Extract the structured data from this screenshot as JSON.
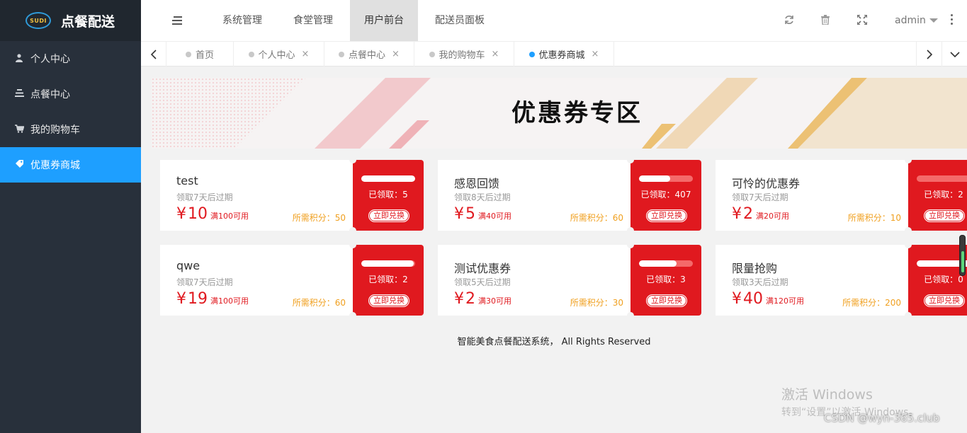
{
  "app": {
    "logo_badge": "SUDI",
    "title": "点餐配送"
  },
  "sidebar": {
    "items": [
      {
        "label": "个人中心",
        "icon": "user-icon"
      },
      {
        "label": "点餐中心",
        "icon": "list-icon"
      },
      {
        "label": "我的购物车",
        "icon": "cart-icon"
      },
      {
        "label": "优惠券商城",
        "icon": "tag-icon",
        "active": true
      }
    ]
  },
  "header": {
    "nav": [
      {
        "label": "系统管理"
      },
      {
        "label": "食堂管理"
      },
      {
        "label": "用户前台",
        "active": true
      },
      {
        "label": "配送员面板"
      }
    ],
    "user": "admin"
  },
  "tabs": {
    "items": [
      {
        "label": "首页",
        "closable": false
      },
      {
        "label": "个人中心",
        "closable": true
      },
      {
        "label": "点餐中心",
        "closable": true
      },
      {
        "label": "我的购物车",
        "closable": true
      },
      {
        "label": "优惠券商城",
        "closable": true,
        "active": true
      }
    ],
    "close_glyph": "×"
  },
  "banner": {
    "title": "优惠券专区"
  },
  "coupons": [
    {
      "name": "test",
      "expire": "领取7天后过期",
      "yen": "¥",
      "amount": "10",
      "condition": "满100可用",
      "points": "所需积分：50",
      "claimed": "已领取：5",
      "claimed_fraction": 1.0,
      "redeem": "立即兑换"
    },
    {
      "name": "感恩回馈",
      "expire": "领取8天后过期",
      "yen": "¥",
      "amount": "5",
      "condition": "满40可用",
      "points": "所需积分：60",
      "claimed": "已领取：407",
      "claimed_fraction": 0.58,
      "redeem": "立即兑换"
    },
    {
      "name": "可怜的优惠券",
      "expire": "领取7天后过期",
      "yen": "¥",
      "amount": "2",
      "condition": "满20可用",
      "points": "所需积分：10",
      "claimed": "已领取：2",
      "claimed_fraction": 0.0,
      "redeem": "立即兑换"
    },
    {
      "name": "qwe",
      "expire": "领取7天后过期",
      "yen": "¥",
      "amount": "19",
      "condition": "满100可用",
      "points": "所需积分：60",
      "claimed": "已领取：2",
      "claimed_fraction": 0.97,
      "redeem": "立即兑换"
    },
    {
      "name": "测试优惠券",
      "expire": "领取5天后过期",
      "yen": "¥",
      "amount": "2",
      "condition": "满30可用",
      "points": "所需积分：30",
      "claimed": "已领取：3",
      "claimed_fraction": 0.7,
      "redeem": "立即兑换"
    },
    {
      "name": "限量抢购",
      "expire": "领取3天后过期",
      "yen": "¥",
      "amount": "40",
      "condition": "满120可用",
      "points": "所需积分：200",
      "claimed": "已领取：0",
      "claimed_fraction": 1.0,
      "redeem": "立即兑换"
    }
  ],
  "footer": {
    "text": "智能美食点餐配送系统， All Rights Reserved"
  },
  "overlay": {
    "activate_title": "激活 Windows",
    "activate_sub": "转到“设置”以激活 Windows。",
    "csdn": "CSDN @wyn-365.club"
  },
  "colors": {
    "sidebar_bg": "#28303b",
    "active_blue": "#1e9fff",
    "coupon_red": "#e0191f",
    "points_orange": "#f0a020"
  }
}
